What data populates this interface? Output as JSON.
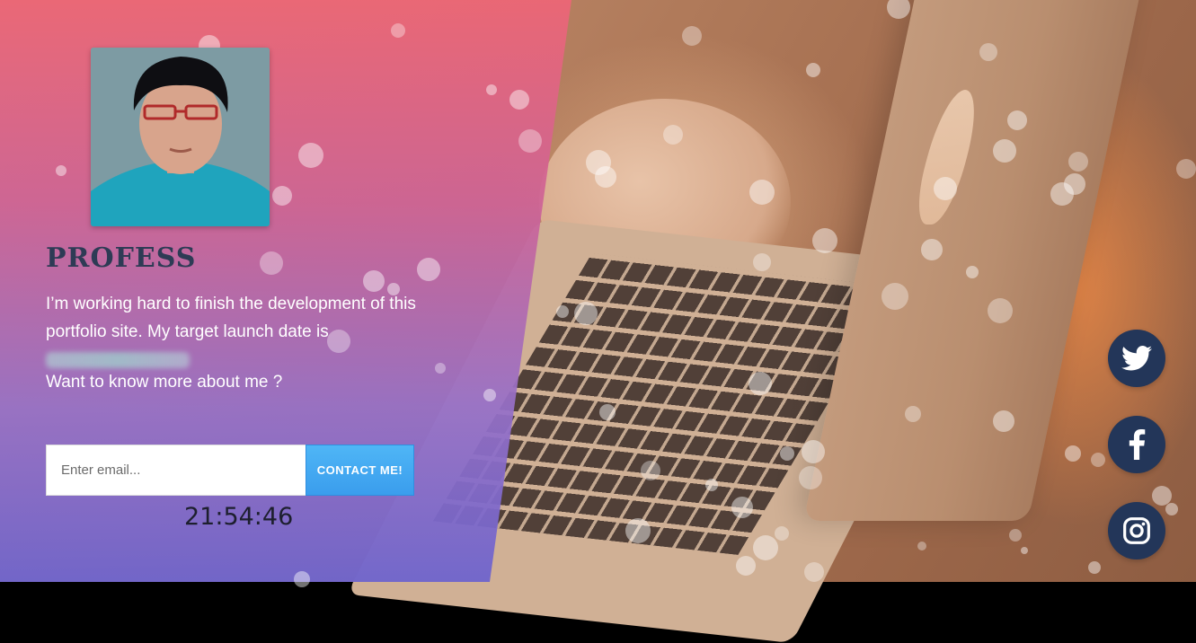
{
  "profile": {
    "brand_name": "PROFESS",
    "description": "I’m working hard to finish the development of this portfolio site. My target launch date is",
    "question": "Want to know more about me ?"
  },
  "form": {
    "email_placeholder": "Enter email...",
    "contact_label": "CONTACT ME!"
  },
  "clock": {
    "time": "21:54:46"
  },
  "social": [
    {
      "name": "twitter-icon"
    },
    {
      "name": "facebook-icon"
    },
    {
      "name": "instagram-icon"
    }
  ],
  "colors": {
    "overlay_top": "#EC6676",
    "overlay_bottom": "#6E64CD",
    "button": "#3A9DED",
    "social_bg": "#233659",
    "brand_text": "#2E3B55"
  }
}
